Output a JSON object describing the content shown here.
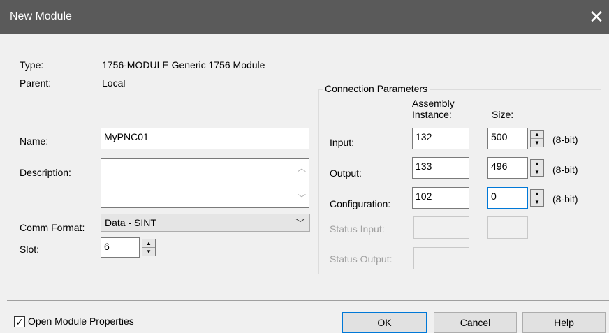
{
  "window": {
    "title": "New Module",
    "close_icon": "close-icon"
  },
  "type": {
    "label": "Type:",
    "value": "1756-MODULE Generic 1756 Module"
  },
  "parent": {
    "label": "Parent:",
    "value": "Local"
  },
  "name": {
    "label": "Name:",
    "value": "MyPNC01"
  },
  "description": {
    "label": "Description:",
    "value": ""
  },
  "comm_format": {
    "label": "Comm Format:",
    "value": "Data - SINT"
  },
  "slot": {
    "label": "Slot:",
    "value": "6"
  },
  "connection": {
    "title": "Connection Parameters",
    "col_assembly": "Assembly",
    "col_instance": "Instance:",
    "col_size": "Size:",
    "unit": "(8-bit)",
    "rows": [
      {
        "label": "Input:",
        "instance": "132",
        "size": "500"
      },
      {
        "label": "Output:",
        "instance": "133",
        "size": "496"
      },
      {
        "label": "Configuration:",
        "instance": "102",
        "size": "0"
      }
    ],
    "status_input": {
      "label": "Status Input:"
    },
    "status_output": {
      "label": "Status Output:"
    }
  },
  "footer": {
    "open_props": {
      "label": "Open Module Properties",
      "checked": true
    },
    "ok": "OK",
    "cancel": "Cancel",
    "help": "Help"
  }
}
